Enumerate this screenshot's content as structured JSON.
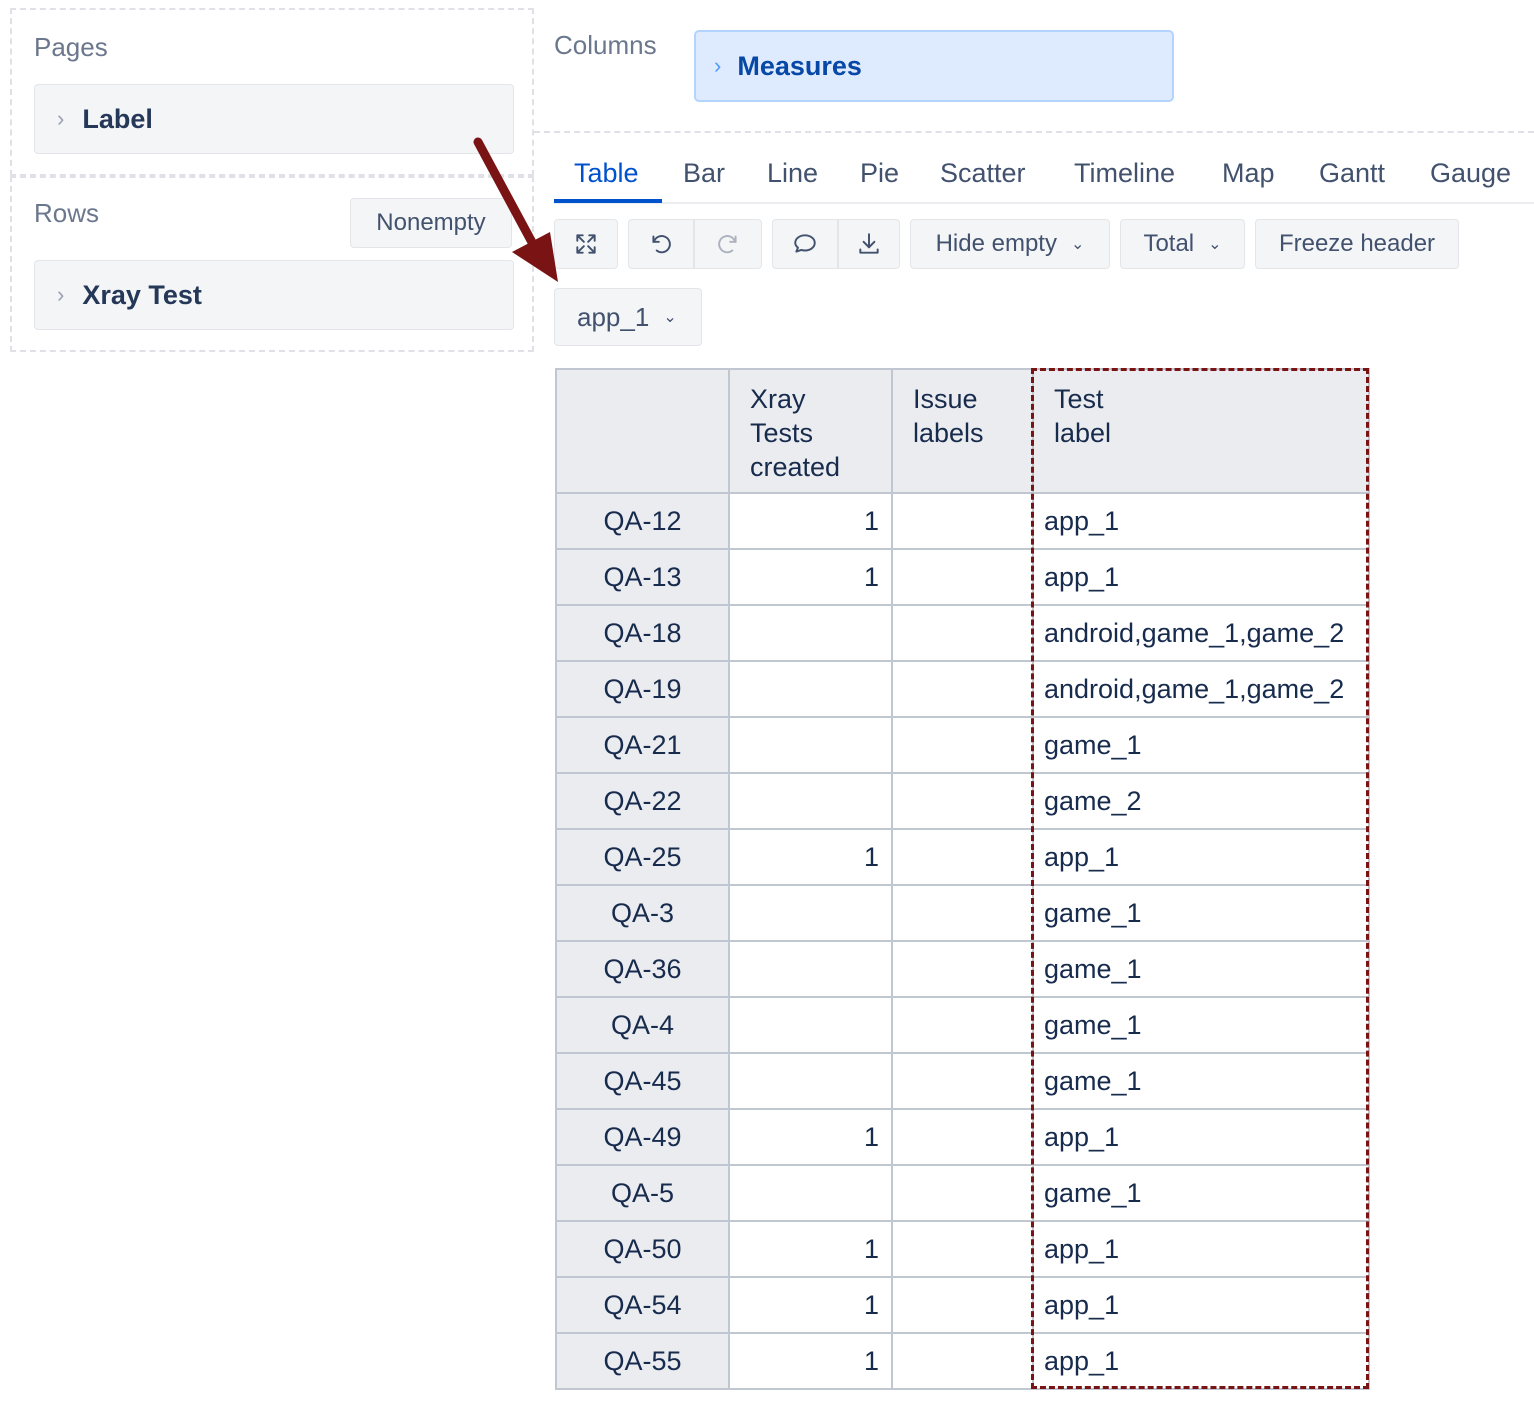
{
  "pages_panel": {
    "title": "Pages",
    "dimension": "Label"
  },
  "rows_panel": {
    "title": "Rows",
    "nonempty_label": "Nonempty",
    "dimension": "Xray Test"
  },
  "columns_panel": {
    "title": "Columns",
    "dimension": "Measures"
  },
  "tabs": [
    "Table",
    "Bar",
    "Line",
    "Pie",
    "Scatter",
    "Timeline",
    "Map",
    "Gantt",
    "Gauge"
  ],
  "active_tab": "Table",
  "toolbar": {
    "hide_empty_label": "Hide empty",
    "total_label": "Total",
    "freeze_header_label": "Freeze header"
  },
  "page_selector": {
    "value": "app_1"
  },
  "table": {
    "headers": [
      "",
      "Xray Tests created",
      "Issue labels",
      "Test label"
    ],
    "rows": [
      {
        "key": "QA-12",
        "created": "1",
        "issue_labels": "",
        "test_label": "app_1"
      },
      {
        "key": "QA-13",
        "created": "1",
        "issue_labels": "",
        "test_label": "app_1"
      },
      {
        "key": "QA-18",
        "created": "",
        "issue_labels": "",
        "test_label": "android,game_1,game_2"
      },
      {
        "key": "QA-19",
        "created": "",
        "issue_labels": "",
        "test_label": "android,game_1,game_2"
      },
      {
        "key": "QA-21",
        "created": "",
        "issue_labels": "",
        "test_label": "game_1"
      },
      {
        "key": "QA-22",
        "created": "",
        "issue_labels": "",
        "test_label": "game_2"
      },
      {
        "key": "QA-25",
        "created": "1",
        "issue_labels": "",
        "test_label": "app_1"
      },
      {
        "key": "QA-3",
        "created": "",
        "issue_labels": "",
        "test_label": "game_1"
      },
      {
        "key": "QA-36",
        "created": "",
        "issue_labels": "",
        "test_label": "game_1"
      },
      {
        "key": "QA-4",
        "created": "",
        "issue_labels": "",
        "test_label": "game_1"
      },
      {
        "key": "QA-45",
        "created": "",
        "issue_labels": "",
        "test_label": "game_1"
      },
      {
        "key": "QA-49",
        "created": "1",
        "issue_labels": "",
        "test_label": "app_1"
      },
      {
        "key": "QA-5",
        "created": "",
        "issue_labels": "",
        "test_label": "game_1"
      },
      {
        "key": "QA-50",
        "created": "1",
        "issue_labels": "",
        "test_label": "app_1"
      },
      {
        "key": "QA-54",
        "created": "1",
        "issue_labels": "",
        "test_label": "app_1"
      },
      {
        "key": "QA-55",
        "created": "1",
        "issue_labels": "",
        "test_label": "app_1"
      }
    ]
  },
  "icons": [
    "chevron-right-icon",
    "fullscreen-icon",
    "undo-icon",
    "redo-icon",
    "comment-icon",
    "download-icon",
    "chevron-down-icon",
    "annotation-arrow"
  ],
  "colors": {
    "accent": "#0052cc",
    "measures_chip": "#deebff",
    "annotation": "#7a1414"
  }
}
